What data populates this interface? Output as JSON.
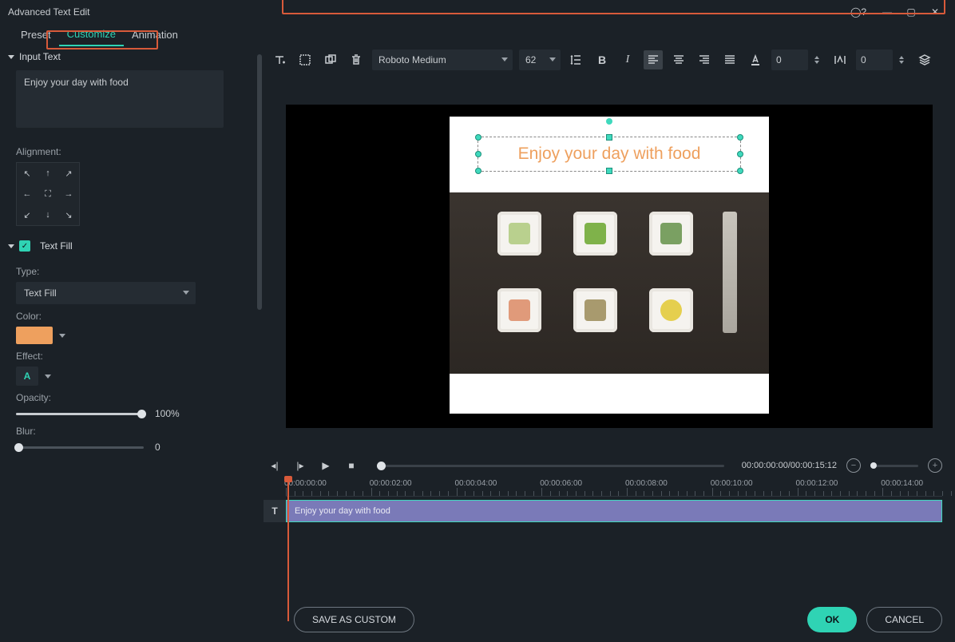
{
  "window": {
    "title": "Advanced Text Edit"
  },
  "tabs": {
    "preset": "Preset",
    "customize": "Customize",
    "animation": "Animation"
  },
  "sidebar": {
    "input_section": "Input Text",
    "input_value": "Enjoy your day with food",
    "alignment_label": "Alignment:",
    "textfill_section": "Text Fill",
    "type_label": "Type:",
    "type_value": "Text Fill",
    "color_label": "Color:",
    "color_hex": "#eea05e",
    "effect_label": "Effect:",
    "effect_letter": "A",
    "opacity_label": "Opacity:",
    "opacity_value": "100%",
    "blur_label": "Blur:",
    "blur_value": "0"
  },
  "toolbar": {
    "font": "Roboto Medium",
    "size": "62",
    "line_spacing": "0",
    "char_spacing": "0"
  },
  "preview": {
    "overlay_text": "Enjoy your day with food"
  },
  "playback": {
    "time": "00:00:00:00/00:00:15:12"
  },
  "timeline": {
    "labels": [
      "00:00:00:00",
      "00:00:02:00",
      "00:00:04:00",
      "00:00:06:00",
      "00:00:08:00",
      "00:00:10:00",
      "00:00:12:00",
      "00:00:14:00"
    ],
    "clip_text": "Enjoy your day with food",
    "track_icon": "T"
  },
  "footer": {
    "save": "SAVE AS CUSTOM",
    "ok": "OK",
    "cancel": "CANCEL"
  }
}
